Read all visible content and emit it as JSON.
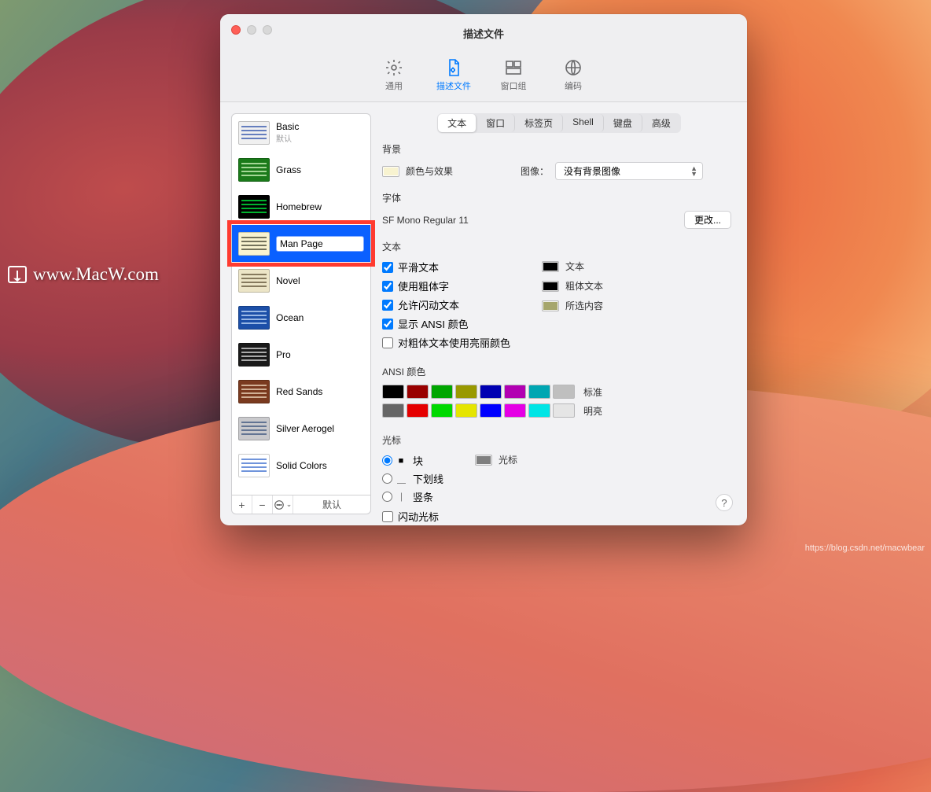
{
  "watermark": {
    "text": "www.MacW.com"
  },
  "footer_credit": "https://blog.csdn.net/macwbear",
  "window": {
    "title": "描述文件",
    "toolbar": [
      {
        "id": "general",
        "label": "通用",
        "icon": "gear-icon",
        "active": false
      },
      {
        "id": "profiles",
        "label": "描述文件",
        "icon": "document-gear-icon",
        "active": true
      },
      {
        "id": "groups",
        "label": "窗口组",
        "icon": "window-group-icon",
        "active": false
      },
      {
        "id": "encoding",
        "label": "编码",
        "icon": "globe-icon",
        "active": false
      }
    ]
  },
  "profiles": {
    "items": [
      {
        "name": "Basic",
        "default_label": "默认",
        "is_default": true,
        "thumb_bg": "#f0f0f0",
        "thumb_fg": "#2a4da8"
      },
      {
        "name": "Grass",
        "thumb_bg": "#1a7a1a",
        "thumb_fg": "#e0ffcc"
      },
      {
        "name": "Homebrew",
        "thumb_bg": "#000000",
        "thumb_fg": "#00ff41"
      },
      {
        "name": "Man Page",
        "selected": true,
        "editing": true,
        "thumb_bg": "#f8f3d0",
        "thumb_fg": "#3a3a2a"
      },
      {
        "name": "Novel",
        "thumb_bg": "#ece5c7",
        "thumb_fg": "#5a4b31"
      },
      {
        "name": "Ocean",
        "thumb_bg": "#1c4fa8",
        "thumb_fg": "#cfe5ff"
      },
      {
        "name": "Pro",
        "thumb_bg": "#1a1a1a",
        "thumb_fg": "#e8e8e8"
      },
      {
        "name": "Red Sands",
        "thumb_bg": "#7a3a1f",
        "thumb_fg": "#f6e2c7"
      },
      {
        "name": "Silver Aerogel",
        "thumb_bg": "#c9c9cc",
        "thumb_fg": "#36507a"
      },
      {
        "name": "Solid Colors",
        "thumb_bg": "#ffffff",
        "thumb_fg": "#3366cc"
      }
    ],
    "footer": {
      "add": "+",
      "remove": "−",
      "more_icon": "ellipsis-circle-icon",
      "default_btn": "默认"
    }
  },
  "tabs": {
    "items": [
      {
        "id": "text",
        "label": "文本",
        "active": true
      },
      {
        "id": "window",
        "label": "窗口"
      },
      {
        "id": "tab",
        "label": "标签页"
      },
      {
        "id": "shell",
        "label": "Shell"
      },
      {
        "id": "kbd",
        "label": "键盘"
      },
      {
        "id": "adv",
        "label": "高级"
      }
    ]
  },
  "background": {
    "section_title": "背景",
    "color_effects_label": "颜色与效果",
    "color_value": "#f8f3d0",
    "image_label": "图像：",
    "image_select_value": "没有背景图像"
  },
  "font": {
    "section_title": "字体",
    "current": "SF Mono Regular 11",
    "change_btn": "更改..."
  },
  "text": {
    "section_title": "文本",
    "smooth": {
      "label": "平滑文本",
      "checked": true
    },
    "bold": {
      "label": "使用粗体字",
      "checked": true
    },
    "blink": {
      "label": "允许闪动文本",
      "checked": true
    },
    "ansi": {
      "label": "显示 ANSI 颜色",
      "checked": true
    },
    "bright": {
      "label": "对粗体文本使用亮丽颜色",
      "checked": false
    },
    "color_text": {
      "label": "文本",
      "value": "#000000"
    },
    "color_bold": {
      "label": "粗体文本",
      "value": "#000000"
    },
    "color_selection": {
      "label": "所选内容",
      "value": "#a6a66c"
    }
  },
  "ansi": {
    "section_title": "ANSI 颜色",
    "normal_label": "标准",
    "bright_label": "明亮",
    "normal": [
      "#000000",
      "#990000",
      "#00a600",
      "#999900",
      "#0000b2",
      "#b200b2",
      "#00a6b2",
      "#bfbfbf"
    ],
    "bright": [
      "#666666",
      "#e50000",
      "#00d900",
      "#e5e500",
      "#0000ff",
      "#e500e5",
      "#00e5e5",
      "#e5e5e5"
    ]
  },
  "cursor": {
    "section_title": "光标",
    "block": {
      "label": "块",
      "glyph": "■",
      "selected": true
    },
    "underline": {
      "label": "下划线",
      "glyph": "＿",
      "selected": false
    },
    "bar": {
      "label": "竖条",
      "glyph": "｜",
      "selected": false
    },
    "blink_cursor": {
      "label": "闪动光标",
      "checked": false
    },
    "color": {
      "label": "光标",
      "value": "#7f7f7f"
    }
  },
  "help_label": "?"
}
